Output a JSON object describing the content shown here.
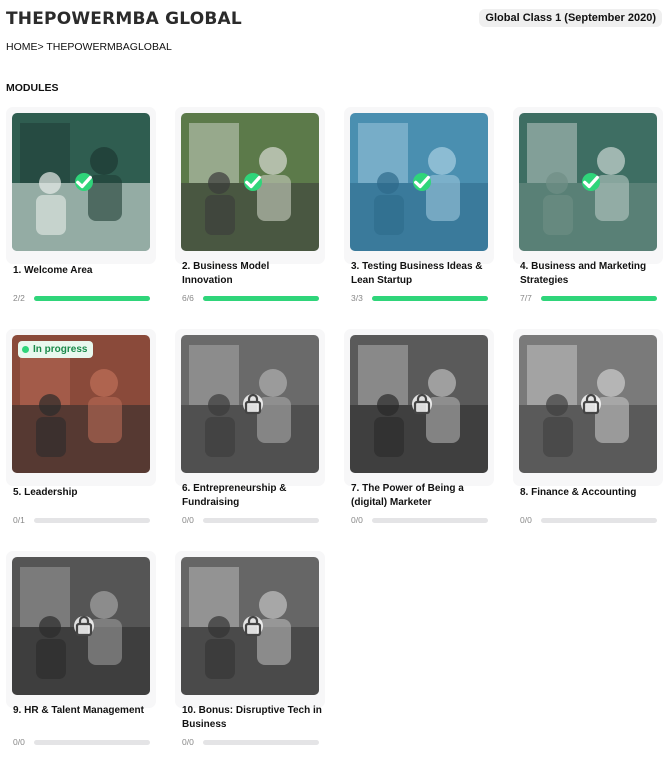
{
  "header": {
    "brand": "THEPOWERMBA GLOBAL",
    "class_badge": "Global Class 1 (September 2020)"
  },
  "breadcrumb": "HOME> THEPOWERMBAGLOBAL",
  "section_title": "MODULES",
  "in_progress_label": "In progress",
  "colors": {
    "accent": "#2fd57a",
    "track": "#e4e4e6",
    "card": "#f7f7f8"
  },
  "modules": [
    {
      "title": "1. Welcome Area",
      "progress": "2/2",
      "fraction": 1,
      "status": "completed",
      "icon": "check-icon"
    },
    {
      "title": "2. Business Model Innovation",
      "progress": "6/6",
      "fraction": 1,
      "status": "completed",
      "icon": "check-icon"
    },
    {
      "title": "3. Testing Business Ideas & Lean Startup",
      "progress": "3/3",
      "fraction": 1,
      "status": "completed",
      "icon": "check-icon"
    },
    {
      "title": "4. Business and Marketing Strategies",
      "progress": "7/7",
      "fraction": 1,
      "status": "completed",
      "icon": "check-icon"
    },
    {
      "title": "5. Leadership",
      "progress": "0/1",
      "fraction": 0,
      "status": "in-progress",
      "icon": ""
    },
    {
      "title": "6. Entrepreneurship & Fundraising",
      "progress": "0/0",
      "fraction": 0,
      "status": "locked",
      "icon": "lock-icon"
    },
    {
      "title": "7. The Power of Being a (digital) Marketer",
      "progress": "0/0",
      "fraction": 0,
      "status": "locked",
      "icon": "lock-icon"
    },
    {
      "title": "8. Finance & Accounting",
      "progress": "0/0",
      "fraction": 0,
      "status": "locked",
      "icon": "lock-icon"
    },
    {
      "title": "9. HR & Talent Management",
      "progress": "0/0",
      "fraction": 0,
      "status": "locked",
      "icon": "lock-icon"
    },
    {
      "title": "10. Bonus: Disruptive Tech in Business",
      "progress": "0/0",
      "fraction": 0,
      "status": "locked",
      "icon": "lock-icon"
    }
  ]
}
